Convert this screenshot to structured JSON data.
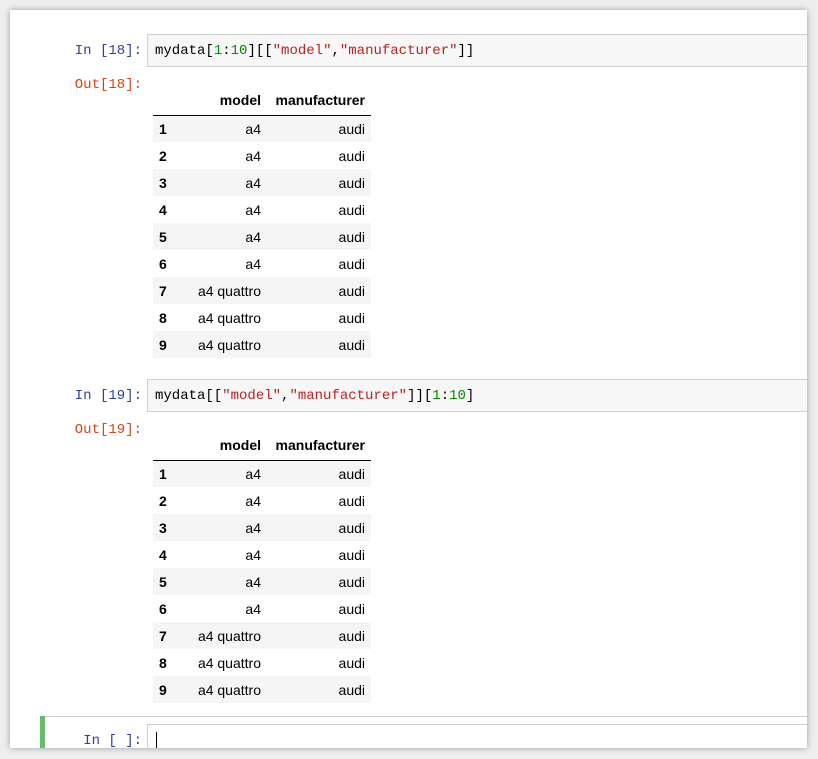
{
  "cells": [
    {
      "in_prompt": "In  [18]:",
      "out_prompt": "Out[18]:",
      "code_tokens": [
        {
          "t": "mydata[",
          "k": "op"
        },
        {
          "t": "1",
          "k": "num"
        },
        {
          "t": ":",
          "k": "op"
        },
        {
          "t": "10",
          "k": "num"
        },
        {
          "t": "][[",
          "k": "op"
        },
        {
          "t": "\"model\"",
          "k": "str"
        },
        {
          "t": ",",
          "k": "op"
        },
        {
          "t": "\"manufacturer\"",
          "k": "str"
        },
        {
          "t": "]]",
          "k": "op"
        }
      ]
    },
    {
      "in_prompt": "In  [19]:",
      "out_prompt": "Out[19]:",
      "code_tokens": [
        {
          "t": "mydata[[",
          "k": "op"
        },
        {
          "t": "\"model\"",
          "k": "str"
        },
        {
          "t": ",",
          "k": "op"
        },
        {
          "t": "\"manufacturer\"",
          "k": "str"
        },
        {
          "t": "]][",
          "k": "op"
        },
        {
          "t": "1",
          "k": "num"
        },
        {
          "t": ":",
          "k": "op"
        },
        {
          "t": "10",
          "k": "num"
        },
        {
          "t": "]",
          "k": "op"
        }
      ]
    }
  ],
  "table": {
    "columns": [
      "model",
      "manufacturer"
    ],
    "rows": [
      {
        "index": "1",
        "model": "a4",
        "manufacturer": "audi"
      },
      {
        "index": "2",
        "model": "a4",
        "manufacturer": "audi"
      },
      {
        "index": "3",
        "model": "a4",
        "manufacturer": "audi"
      },
      {
        "index": "4",
        "model": "a4",
        "manufacturer": "audi"
      },
      {
        "index": "5",
        "model": "a4",
        "manufacturer": "audi"
      },
      {
        "index": "6",
        "model": "a4",
        "manufacturer": "audi"
      },
      {
        "index": "7",
        "model": "a4 quattro",
        "manufacturer": "audi"
      },
      {
        "index": "8",
        "model": "a4 quattro",
        "manufacturer": "audi"
      },
      {
        "index": "9",
        "model": "a4 quattro",
        "manufacturer": "audi"
      }
    ]
  },
  "empty_cell": {
    "in_prompt": "In  [ ]:",
    "code": ""
  },
  "colors": {
    "in_prompt": "#303f9f",
    "out_prompt": "#d84315",
    "number_token": "#008800",
    "string_token": "#ba2121",
    "active_cell_bar": "#66bb6a"
  }
}
